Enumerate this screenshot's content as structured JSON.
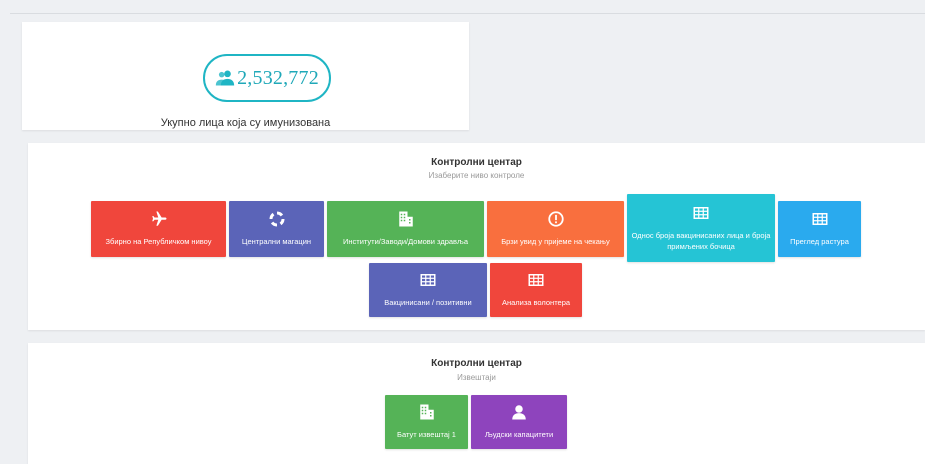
{
  "stats": {
    "total_value": "2,532,772",
    "caption": "Укупно лица која су имунизована",
    "accent": "#1fb5c4"
  },
  "control_center": {
    "title": "Контролни центар",
    "subtitle": "Изаберите ниво контроле",
    "tiles": [
      {
        "label": "Збирно на Републичком нивоу",
        "icon": "airplane-icon",
        "color": "#f0463c"
      },
      {
        "label": "Централни магацин",
        "icon": "lifebuoy-icon",
        "color": "#5b64b8"
      },
      {
        "label": "Институти/Заводи/Домови здравља",
        "icon": "building-icon",
        "color": "#55b357"
      },
      {
        "label": "Брзи увид у пријеме на чекању",
        "icon": "alert-circle-icon",
        "color": "#f96f3e"
      },
      {
        "label": "Однос броја вакцинисаних лица и броја примљених бочица",
        "icon": "grid-icon",
        "color": "#25c4d5"
      },
      {
        "label": "Преглед растура",
        "icon": "grid-icon",
        "color": "#2aaaee"
      },
      {
        "label": "Вакцинисани / позитивни",
        "icon": "grid-icon",
        "color": "#5b64b8"
      },
      {
        "label": "Анализа волонтера",
        "icon": "grid-icon",
        "color": "#f0463c"
      }
    ]
  },
  "reports_center": {
    "title": "Контролни центар",
    "subtitle": "Извештаји",
    "tiles": [
      {
        "label": "Батут извештај 1",
        "icon": "building-icon",
        "color": "#55b357"
      },
      {
        "label": "Људски капацитети",
        "icon": "person-icon",
        "color": "#8e44bd"
      }
    ]
  }
}
